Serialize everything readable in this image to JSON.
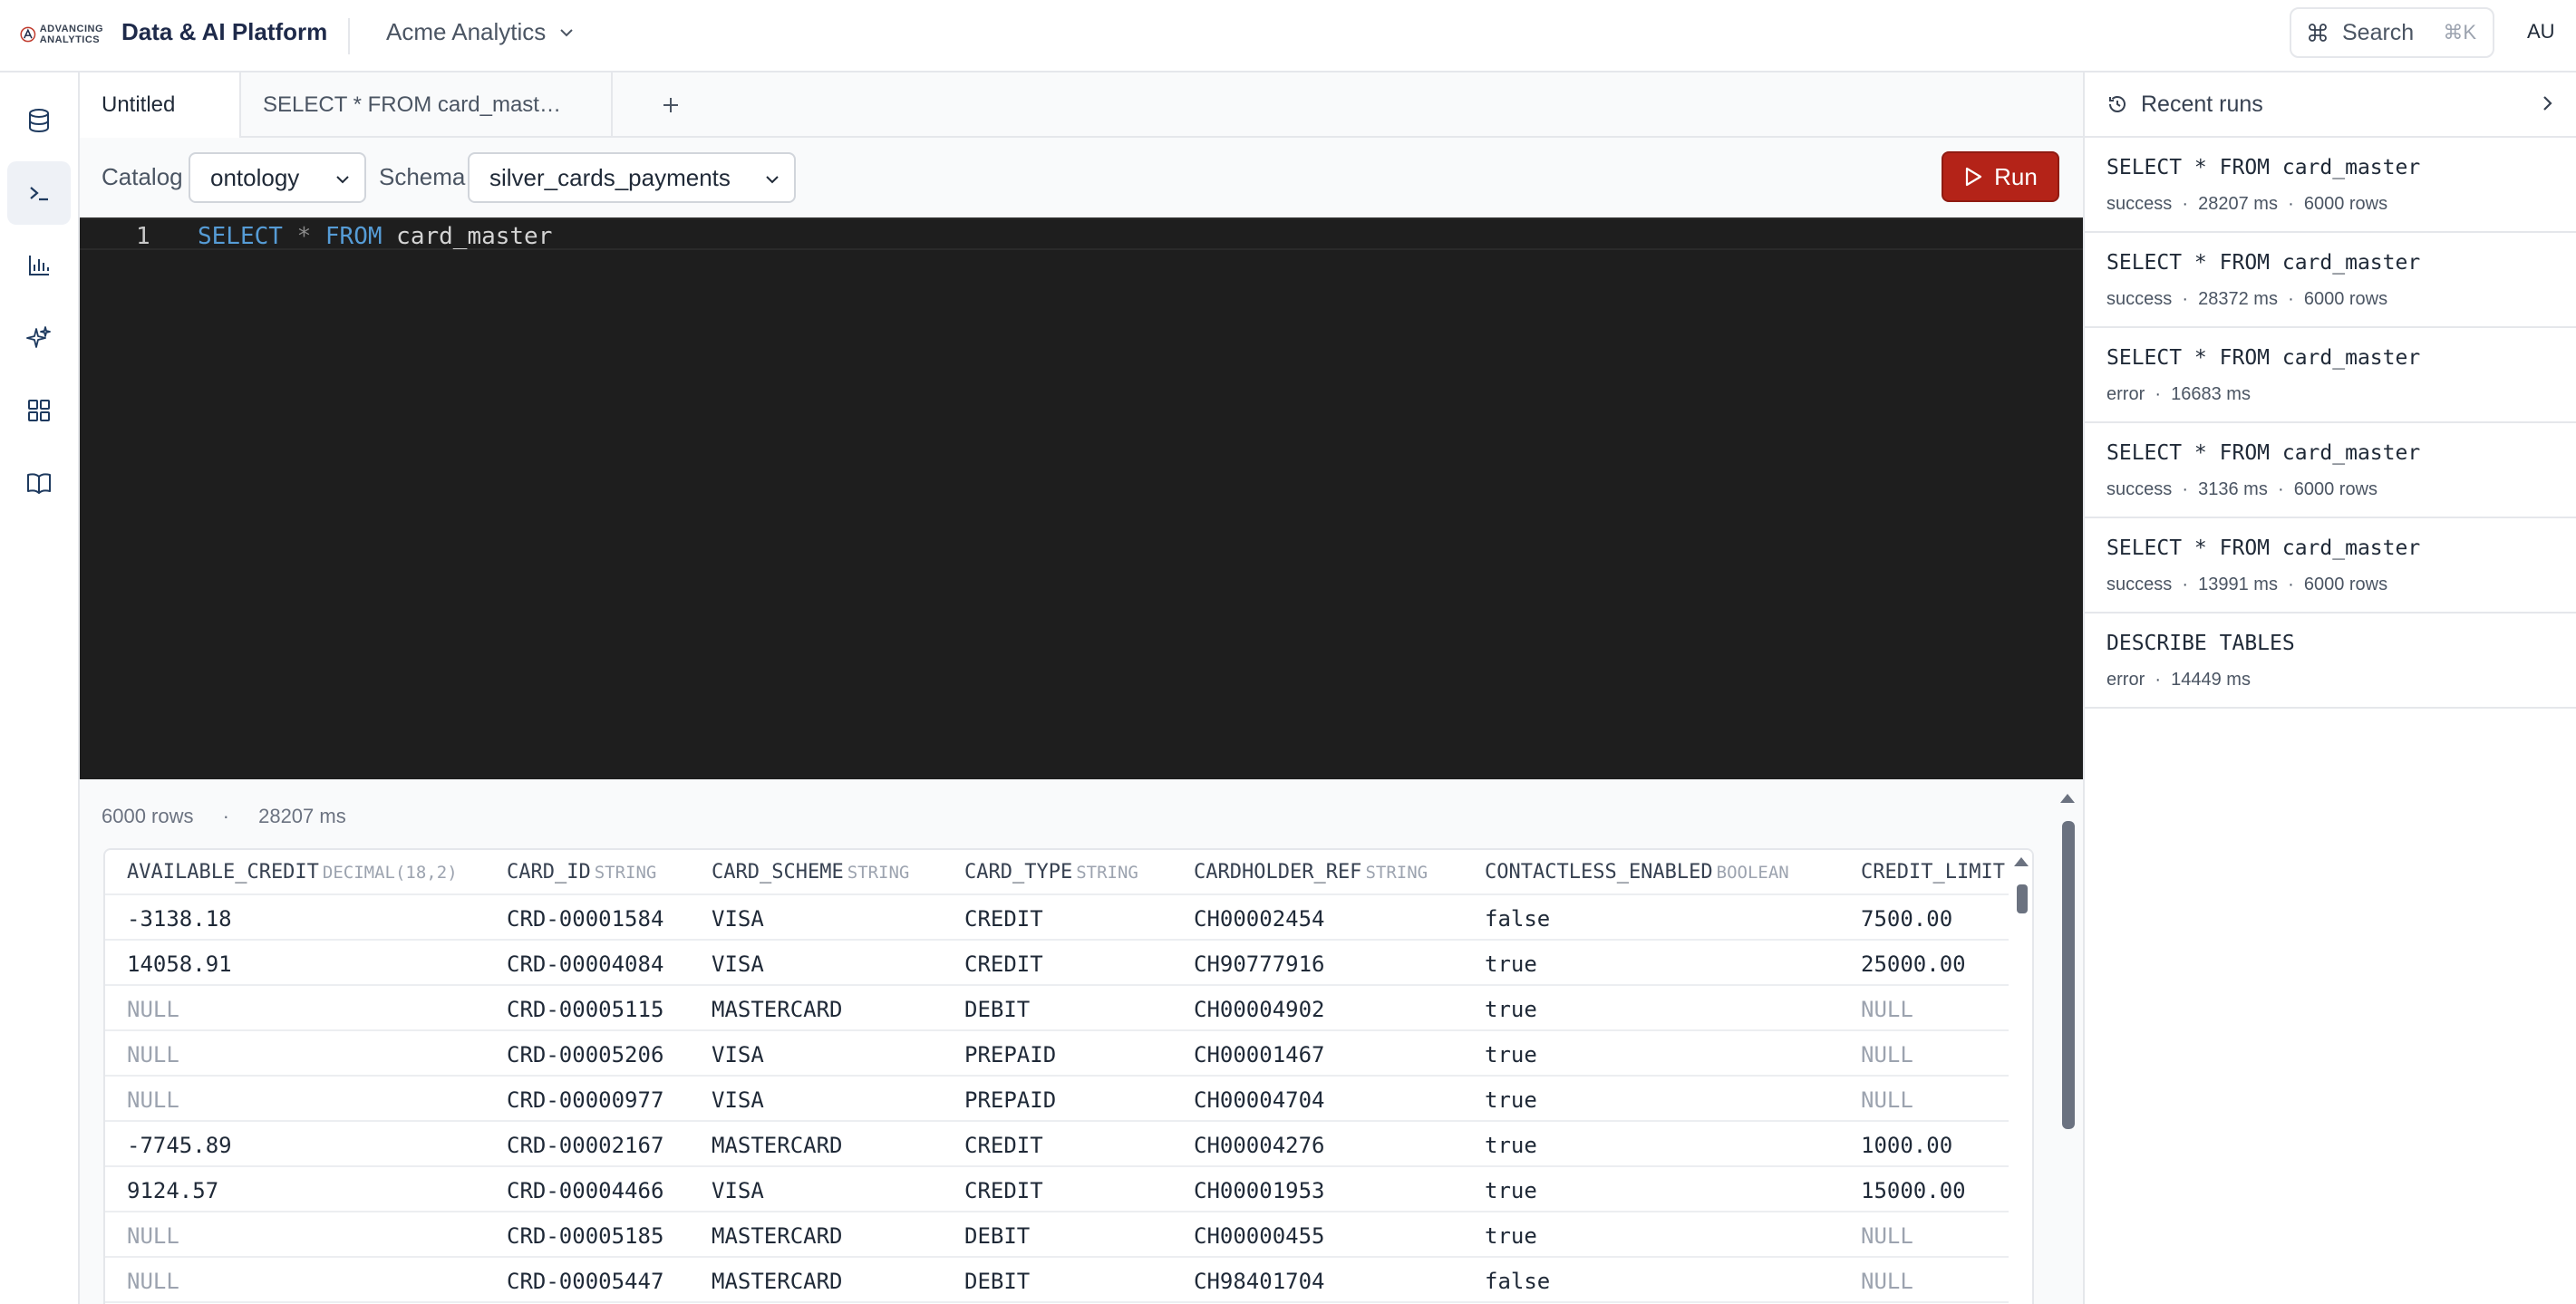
{
  "topbar": {
    "logo_text_line1": "ADVANCING",
    "logo_text_line2": "ANALYTICS",
    "app_title": "Data & AI Platform",
    "workspace": "Acme Analytics",
    "search_label": "Search",
    "search_shortcut": "⌘K",
    "avatar_initials": "AU"
  },
  "rail": {
    "items": [
      {
        "icon": "database-icon",
        "active": false
      },
      {
        "icon": "terminal-icon",
        "active": true
      },
      {
        "icon": "bar-chart-icon",
        "active": false
      },
      {
        "icon": "sparkle-icon",
        "active": false
      },
      {
        "icon": "grid-icon",
        "active": false
      },
      {
        "icon": "book-icon",
        "active": false
      }
    ]
  },
  "tabs": [
    {
      "label": "Untitled",
      "active": true
    },
    {
      "label": "SELECT * FROM card_mast…",
      "active": false
    }
  ],
  "toolbar": {
    "catalog_label": "Catalog",
    "catalog_value": "ontology",
    "schema_label": "Schema",
    "schema_value": "silver_cards_payments",
    "run_label": "Run"
  },
  "editor": {
    "line_number": "1",
    "kw_select": "SELECT",
    "star": "*",
    "kw_from": "FROM",
    "table": "card_master"
  },
  "results": {
    "row_count": "6000 rows",
    "separator": "·",
    "duration": "28207 ms",
    "columns": [
      {
        "name": "AVAILABLE_CREDIT",
        "type": "DECIMAL(18,2)"
      },
      {
        "name": "CARD_ID",
        "type": "STRING"
      },
      {
        "name": "CARD_SCHEME",
        "type": "STRING"
      },
      {
        "name": "CARD_TYPE",
        "type": "STRING"
      },
      {
        "name": "CARDHOLDER_REF",
        "type": "STRING"
      },
      {
        "name": "CONTACTLESS_ENABLED",
        "type": "BOOLEAN"
      },
      {
        "name": "CREDIT_LIMIT",
        "type": ""
      }
    ],
    "rows": [
      [
        "-3138.18",
        "CRD-00001584",
        "VISA",
        "CREDIT",
        "CH00002454",
        "false",
        "7500.00"
      ],
      [
        "14058.91",
        "CRD-00004084",
        "VISA",
        "CREDIT",
        "CH90777916",
        "true",
        "25000.00"
      ],
      [
        "NULL",
        "CRD-00005115",
        "MASTERCARD",
        "DEBIT",
        "CH00004902",
        "true",
        "NULL"
      ],
      [
        "NULL",
        "CRD-00005206",
        "VISA",
        "PREPAID",
        "CH00001467",
        "true",
        "NULL"
      ],
      [
        "NULL",
        "CRD-00000977",
        "VISA",
        "PREPAID",
        "CH00004704",
        "true",
        "NULL"
      ],
      [
        "-7745.89",
        "CRD-00002167",
        "MASTERCARD",
        "CREDIT",
        "CH00004276",
        "true",
        "1000.00"
      ],
      [
        "9124.57",
        "CRD-00004466",
        "VISA",
        "CREDIT",
        "CH00001953",
        "true",
        "15000.00"
      ],
      [
        "NULL",
        "CRD-00005185",
        "MASTERCARD",
        "DEBIT",
        "CH00000455",
        "true",
        "NULL"
      ],
      [
        "NULL",
        "CRD-00005447",
        "MASTERCARD",
        "DEBIT",
        "CH98401704",
        "false",
        "NULL"
      ]
    ]
  },
  "recent_runs": {
    "title": "Recent runs",
    "items": [
      {
        "query": "SELECT * FROM card_master",
        "meta": "success  ·  28207 ms  ·  6000 rows"
      },
      {
        "query": "SELECT * FROM card_master",
        "meta": "success  ·  28372 ms  ·  6000 rows"
      },
      {
        "query": "SELECT * FROM card_master",
        "meta": "error  ·  16683 ms"
      },
      {
        "query": "SELECT * FROM card_master",
        "meta": "success  ·  3136 ms  ·  6000 rows"
      },
      {
        "query": "SELECT * FROM card_master",
        "meta": "success  ·  13991 ms  ·  6000 rows"
      },
      {
        "query": "DESCRIBE TABLES",
        "meta": "error  ·  14449 ms"
      }
    ]
  },
  "colors": {
    "run_button": "#b42318",
    "editor_bg": "#1e1e1e",
    "keyword": "#569cd6",
    "brand_navy": "#1e2a4a"
  }
}
